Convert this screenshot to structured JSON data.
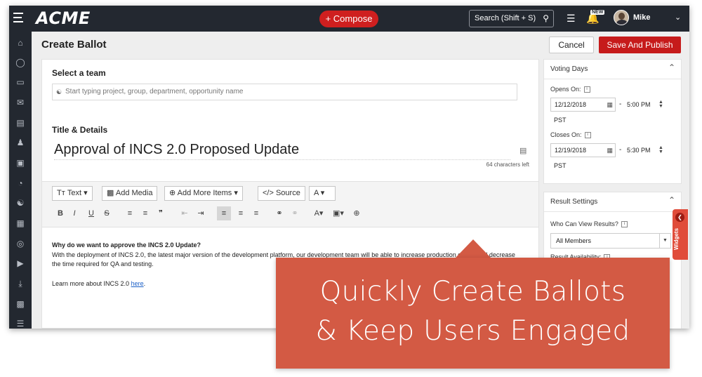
{
  "app": {
    "logo": "ACME",
    "compose_label": "+ Compose",
    "search_label": "Search (Shift + S)",
    "new_badge": "NEW",
    "user_name": "Mike"
  },
  "page": {
    "title": "Create Ballot",
    "cancel_label": "Cancel",
    "publish_label": "Save And Publish"
  },
  "team": {
    "label": "Select a team",
    "placeholder": "Start typing project, group, department, opportunity name"
  },
  "details": {
    "label": "Title & Details",
    "title_value": "Approval of INCS 2.0 Proposed Update",
    "chars_left": "64 characters left"
  },
  "toolbar": {
    "text_label": "Text",
    "add_media_label": "Add Media",
    "add_more_label": "Add More Items",
    "source_label": "Source",
    "font_label": "A"
  },
  "editor": {
    "question": "Why do we want to approve the INCS 2.0 Update?",
    "body_line1": "With the deployment of INCS 2.0, the latest major version of the development platform, our development team will be able to increase production speed and decrease",
    "body_line2": "the time required for QA and testing.",
    "learn_prefix": "Learn more about INCS 2.0 ",
    "learn_link": "here",
    "learn_suffix": "."
  },
  "voting": {
    "title": "Voting Days",
    "opens_label": "Opens On:",
    "opens_date": "12/12/2018",
    "opens_time": "5:00 PM",
    "opens_tz": "PST",
    "closes_label": "Closes On:",
    "closes_date": "12/19/2018",
    "closes_time": "5:30 PM",
    "closes_tz": "PST"
  },
  "results": {
    "title": "Result Settings",
    "who_label": "Who Can View Results?",
    "who_value": "All Members",
    "availability_label": "Result Availability:"
  },
  "widgets_label": "Widgets",
  "callout": {
    "line1": "Quickly Create Ballots",
    "line2": "& Keep Users Engaged"
  }
}
